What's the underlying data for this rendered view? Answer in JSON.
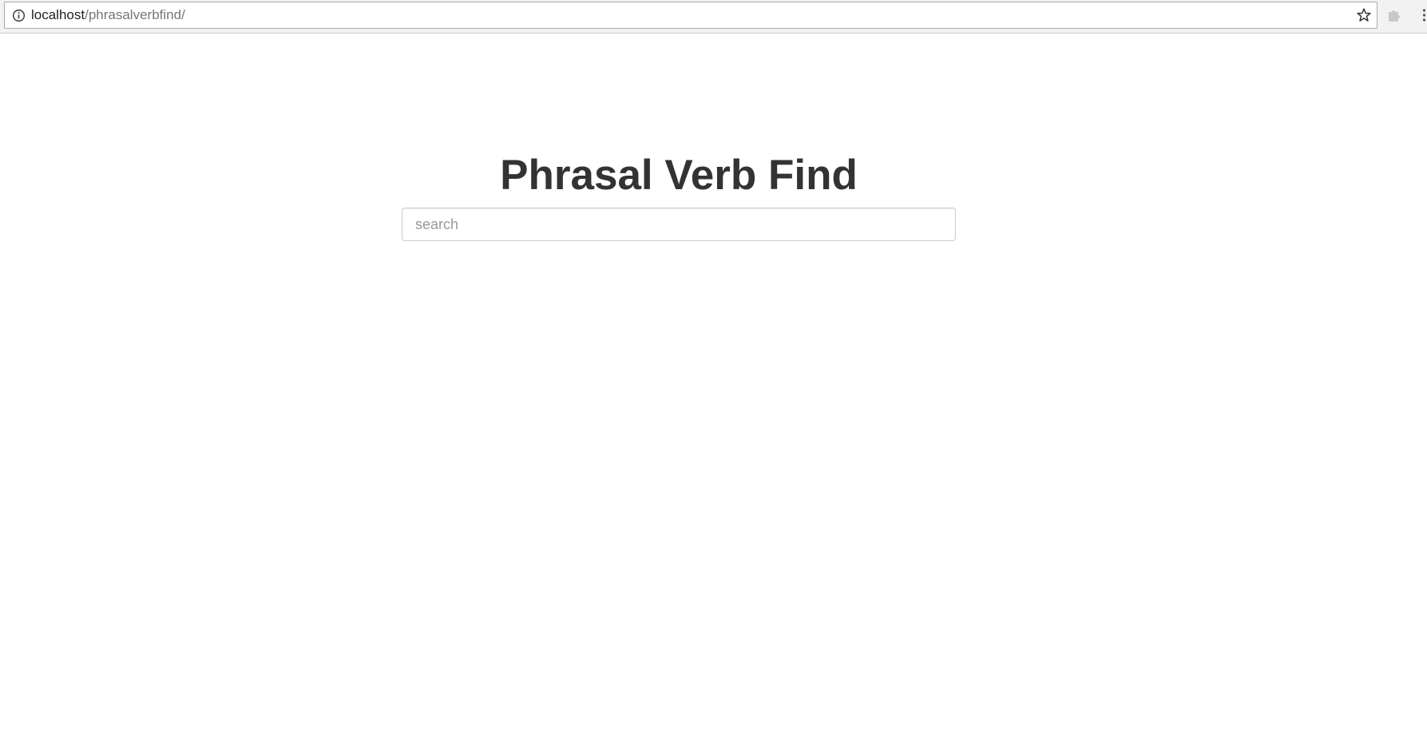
{
  "browser": {
    "url_host": "localhost",
    "url_path": "/phrasalverbfind/",
    "icons": {
      "info": "info-icon",
      "bookmark": "star-icon",
      "extension": "puzzle-icon",
      "menu": "menu-icon"
    }
  },
  "page": {
    "title": "Phrasal Verb Find",
    "search": {
      "placeholder": "search",
      "value": ""
    }
  },
  "colors": {
    "title": "#333333",
    "input_border": "#cccccc",
    "placeholder": "#999999"
  }
}
